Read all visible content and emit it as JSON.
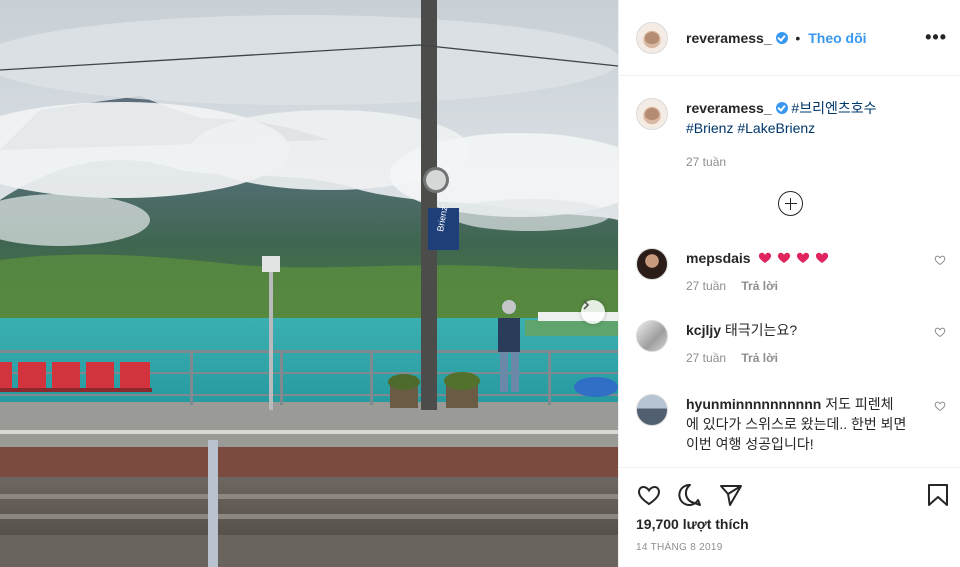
{
  "post": {
    "username": "reveramess_",
    "follow_label": "Theo dõi",
    "more_glyph": "•••",
    "caption": {
      "username": "reveramess_",
      "tags": [
        "#브리엔츠호수",
        "#Brienz",
        "#LakeBrienz"
      ],
      "time": "27 tuần"
    },
    "comments": [
      {
        "username": "mepsdais",
        "text": "",
        "emoji": "heart-emoji x4",
        "time": "27 tuần",
        "reply": "Trả lời"
      },
      {
        "username": "kcjljy",
        "text": "태극기는요?",
        "time": "27 tuần",
        "reply": "Trả lời"
      },
      {
        "username": "hyunminnnnnnnnnn",
        "text": "저도 피렌체 에 있다가 스위스로 왔는데.. 한번 뵈면 이번 여행 성공입니다!"
      }
    ],
    "likes": "19,700 lượt thích",
    "date": "14 THÁNG 8 2019",
    "photo": {
      "sign_text": "Brienz",
      "description_icon": "lake-landscape-photo"
    }
  },
  "colors": {
    "link": "#00376b",
    "follow": "#3897f0",
    "verified": "#3897f0",
    "heart_emoji": "#e0245e",
    "lake": "#2fa7ad",
    "bench": "#d2333c"
  },
  "icons": [
    "verified-icon",
    "more-options-icon",
    "load-more-icon",
    "heart-icon",
    "comment-icon",
    "share-icon",
    "bookmark-icon",
    "next-arrow-icon"
  ]
}
